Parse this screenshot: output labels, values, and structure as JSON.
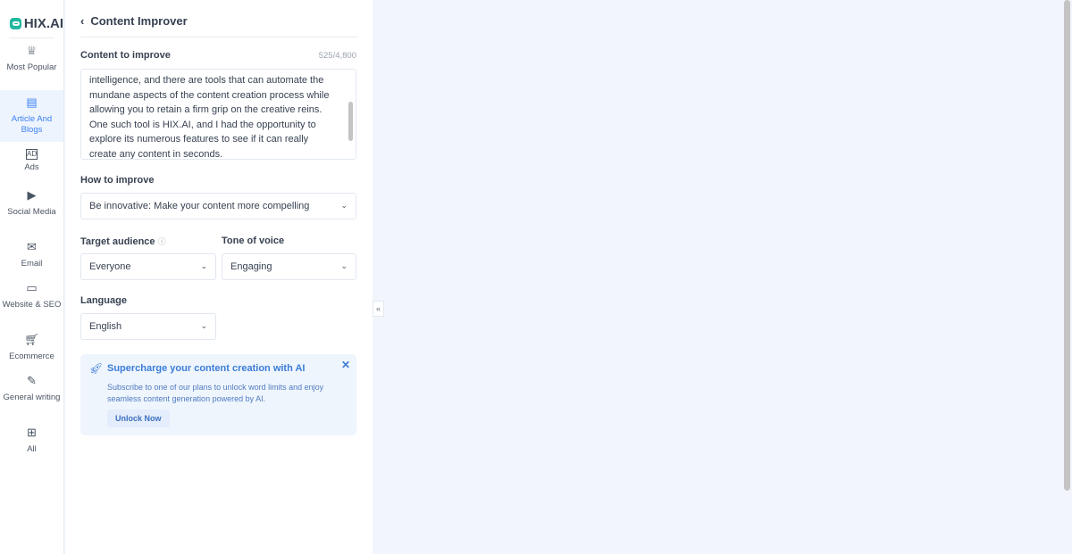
{
  "brand": {
    "name": "HIX.AI",
    "color": "#22b8a0"
  },
  "sidebar": {
    "items": [
      {
        "label": "Most Popular",
        "icon": "crown-icon"
      },
      {
        "label": "Article And Blogs",
        "icon": "article-icon",
        "active": true
      },
      {
        "label": "Ads",
        "icon": "ad-icon"
      },
      {
        "label": "Social Media",
        "icon": "monitor-play-icon"
      },
      {
        "label": "Email",
        "icon": "mail-icon"
      },
      {
        "label": "Website & SEO",
        "icon": "browser-icon"
      },
      {
        "label": "Ecommerce",
        "icon": "cart-icon"
      },
      {
        "label": "General writing",
        "icon": "pencil-icon"
      },
      {
        "label": "All",
        "icon": "grid-icon"
      }
    ]
  },
  "header": {
    "title": "Content Improver"
  },
  "content": {
    "label": "Content to improve",
    "counter": "525/4,800",
    "value": "intelligence, and there are tools that can automate the mundane aspects of the content creation process while allowing you to retain a firm grip on the creative reins. One such tool is HIX.AI, and I had the opportunity to explore its numerous features to see if it can really create any content in seconds."
  },
  "how": {
    "label": "How to improve",
    "value": "Be innovative: Make your content more compelling"
  },
  "audience": {
    "label": "Target audience",
    "value": "Everyone"
  },
  "tone": {
    "label": "Tone of voice",
    "value": "Engaging"
  },
  "language": {
    "label": "Language",
    "value": "English"
  },
  "promo": {
    "title": "Supercharge your content creation with AI",
    "text": "Subscribe to one of our plans to unlock word limits and enjoy seamless content generation powered by AI.",
    "button": "Unlock Now"
  },
  "collapse": "«"
}
